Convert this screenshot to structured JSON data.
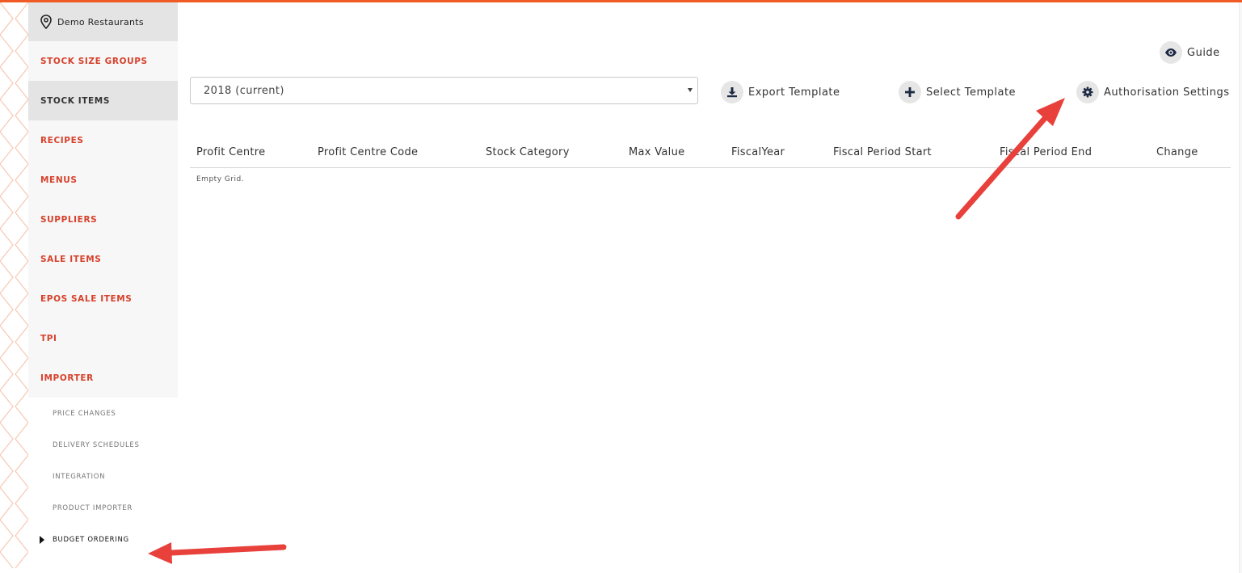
{
  "location": {
    "name": "Demo Restaurants",
    "icon": "map-pin-icon"
  },
  "sidebar": {
    "items": [
      {
        "label": "STOCK SIZE GROUPS",
        "active": false
      },
      {
        "label": "STOCK ITEMS",
        "active": true
      },
      {
        "label": "RECIPES",
        "active": false
      },
      {
        "label": "MENUS",
        "active": false
      },
      {
        "label": "SUPPLIERS",
        "active": false
      },
      {
        "label": "SALE ITEMS",
        "active": false
      },
      {
        "label": "EPOS SALE ITEMS",
        "active": false
      },
      {
        "label": "TPI",
        "active": false
      },
      {
        "label": "IMPORTER",
        "active": false
      }
    ],
    "subitems": [
      {
        "label": "PRICE CHANGES"
      },
      {
        "label": "DELIVERY SCHEDULES"
      },
      {
        "label": "INTEGRATION"
      },
      {
        "label": "PRODUCT IMPORTER"
      },
      {
        "label": "BUDGET ORDERING",
        "current": true
      }
    ]
  },
  "guide": {
    "label": "Guide",
    "icon": "eye-icon"
  },
  "fiscal_year": {
    "selected": "2018 (current)"
  },
  "toolbar": {
    "export_label": "Export Template",
    "select_label": "Select Template",
    "auth_label": "Authorisation Settings"
  },
  "grid": {
    "columns": [
      "Profit Centre",
      "Profit Centre Code",
      "Stock Category",
      "Max Value",
      "FiscalYear",
      "Fiscal Period Start",
      "Fiscal Period End",
      "Change"
    ],
    "empty_text": "Empty Grid."
  },
  "colors": {
    "accent": "#f15a24",
    "nav_text": "#d6412b",
    "annotation_arrow": "#e8413c"
  }
}
